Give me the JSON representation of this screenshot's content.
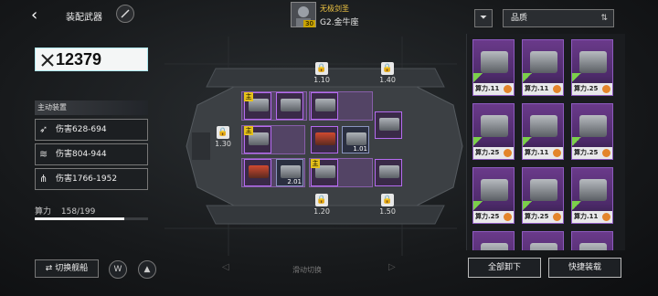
{
  "header": {
    "title": "装配武器",
    "pilot_name": "无极剑圣",
    "pilot_level": "30",
    "pilot_rank": "G2.金牛座"
  },
  "power": {
    "value": "12379"
  },
  "active_equipment": {
    "title": "主动装置",
    "items": [
      {
        "label": "伤害628-694",
        "icon": "missile-icon"
      },
      {
        "label": "伤害804-944",
        "icon": "beam-icon"
      },
      {
        "label": "伤害1766-1952",
        "icon": "multi-missile-icon"
      }
    ]
  },
  "capacity": {
    "label": "算力",
    "used": "158",
    "total": "/199",
    "fraction": 0.794
  },
  "ship": {
    "locked": [
      {
        "val": "1.10"
      },
      {
        "val": "1.40"
      },
      {
        "val": "1.30"
      },
      {
        "val": "1.20"
      },
      {
        "val": "1.50"
      }
    ],
    "slots": [
      {
        "lvl": "",
        "main": "主"
      },
      {
        "lvl": "",
        "main": ""
      },
      {
        "lvl": "",
        "main": ""
      },
      {
        "lvl": "",
        "main": "主"
      },
      {
        "lvl": "",
        "main": ""
      },
      {
        "lvl": "1.01",
        "main": ""
      },
      {
        "lvl": "",
        "main": ""
      },
      {
        "lvl": "",
        "main": ""
      },
      {
        "lvl": "2.01",
        "main": ""
      },
      {
        "lvl": "",
        "main": "主"
      },
      {
        "lvl": "",
        "main": ""
      }
    ]
  },
  "controls": {
    "switch_ship": "切换舰船",
    "swipe_hint": "滑动切换",
    "swipe_left": "◁",
    "swipe_right": "▷"
  },
  "filter": {
    "sort_label": "品质",
    "filter_icon": "funnel-icon"
  },
  "inventory": [
    {
      "label": "算力.11"
    },
    {
      "label": "算力.11"
    },
    {
      "label": "算力.25"
    },
    {
      "label": "算力.25"
    },
    {
      "label": "算力.11"
    },
    {
      "label": "算力.25"
    },
    {
      "label": "算力.25"
    },
    {
      "label": "算力.25"
    },
    {
      "label": "算力.11"
    }
  ],
  "actions": {
    "unload_all": "全部卸下",
    "quick_equip": "快捷装载"
  },
  "colors": {
    "accent": "#5fd3dc",
    "epic": "#6a3a8a",
    "main_tag": "#e6c21a"
  }
}
